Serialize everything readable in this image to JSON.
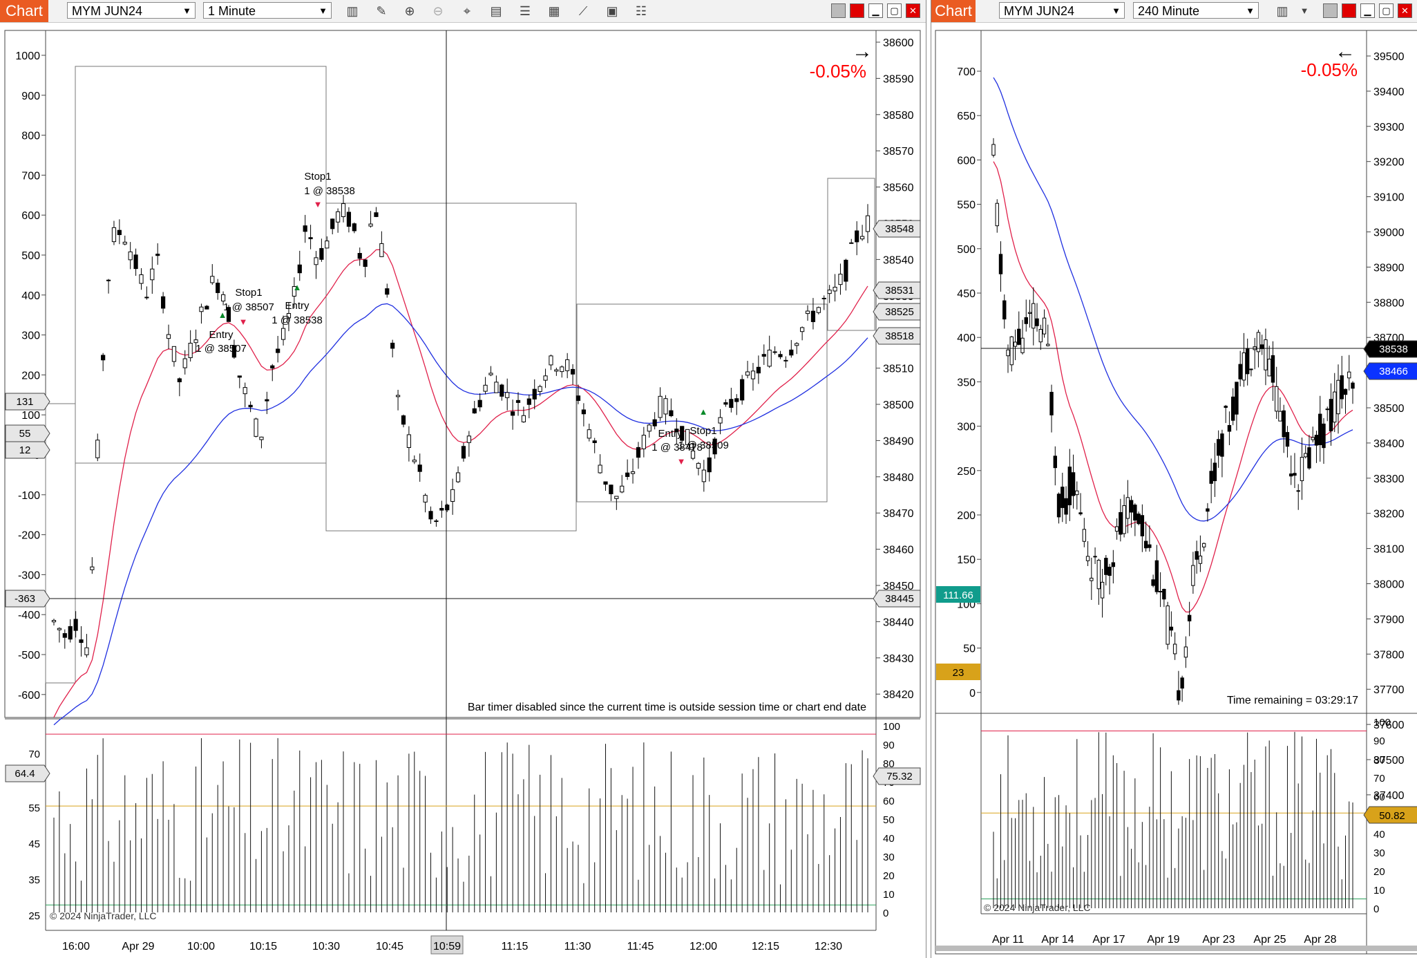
{
  "left": {
    "tab_label": "Chart",
    "instrument": "MYM JUN24",
    "interval": "1 Minute",
    "change_pct": "-0.05%",
    "bar_timer_note": "Bar timer disabled since the current time is outside session time or chart end date",
    "copyright": "© 2024 NinjaTrader, LLC",
    "right_axis_ticks": [
      "38600",
      "38590",
      "38580",
      "38570",
      "38560",
      "38550",
      "38540",
      "38530",
      "38520",
      "38510",
      "38500",
      "38490",
      "38480",
      "38470",
      "38460",
      "38450",
      "38440",
      "38430",
      "38420"
    ],
    "left_axis_ticks": [
      "1000",
      "900",
      "800",
      "700",
      "600",
      "500",
      "400",
      "300",
      "200",
      "100",
      "0",
      "-100",
      "-200",
      "-300",
      "-400",
      "-500",
      "-600"
    ],
    "price_markers": [
      "38548",
      "38531",
      "38525",
      "38518",
      "38445"
    ],
    "left_markers": [
      "131",
      "55",
      "12",
      "-363"
    ],
    "crosshair_time": "10:59",
    "time_labels": [
      "16:00",
      "Apr 29",
      "10:00",
      "10:15",
      "10:30",
      "10:45",
      "11:15",
      "11:30",
      "11:45",
      "12:00",
      "12:15",
      "12:30"
    ],
    "orders": [
      {
        "name": "Stop1",
        "detail": "1 @ 38538"
      },
      {
        "name": "Stop1",
        "detail": "1 @ 38507"
      },
      {
        "name": "Entry",
        "detail": "1 @ 38538"
      },
      {
        "name": "Entry",
        "detail": "1 @ 38507"
      },
      {
        "name": "Stop1",
        "detail": "1 @ 38509"
      },
      {
        "name": "Entry",
        "detail": "1 @ 38478"
      }
    ],
    "ind_left_ticks": [
      "70",
      "55",
      "45",
      "35",
      "25"
    ],
    "ind_left_marker": "64.4",
    "ind_right_ticks": [
      "100",
      "90",
      "80",
      "70",
      "60",
      "50",
      "40",
      "30",
      "20",
      "10",
      "0"
    ],
    "ind_right_marker": "75.32"
  },
  "right": {
    "tab_label": "Chart",
    "instrument": "MYM JUN24",
    "interval": "240 Minute",
    "change_pct": "-0.05%",
    "time_remaining": "Time remaining = 03:29:17",
    "copyright": "© 2024 NinjaTrader, LLC",
    "right_axis_ticks": [
      "39500",
      "39400",
      "39300",
      "39200",
      "39100",
      "39000",
      "38900",
      "38800",
      "38700",
      "38600",
      "38500",
      "38400",
      "38300",
      "38200",
      "38100",
      "38000",
      "37900",
      "37800",
      "37700",
      "37600",
      "37500",
      "37400"
    ],
    "left_axis_ticks": [
      "700",
      "650",
      "600",
      "550",
      "500",
      "450",
      "400",
      "350",
      "300",
      "250",
      "200",
      "150",
      "100",
      "50",
      "0"
    ],
    "price_markers": [
      "38538",
      "38466"
    ],
    "left_markers": [
      "111.66",
      "23"
    ],
    "time_labels": [
      "Apr 11",
      "Apr 14",
      "Apr 17",
      "Apr 19",
      "Apr 23",
      "Apr 25",
      "Apr 28"
    ],
    "ind_right_ticks": [
      "100",
      "90",
      "80",
      "70",
      "60",
      "50",
      "40",
      "30",
      "20",
      "10",
      "0"
    ],
    "ind_right_marker": "50.82"
  },
  "colors": {
    "tab": "#ea5b22",
    "pct": "#ff0000",
    "ema_fast": "#e0204a",
    "ema_slow": "#1f2fe0",
    "level_red": "#e0204a",
    "level_gold": "#d8a21a",
    "level_green": "#2aa05a",
    "marker_teal": "#109c8c",
    "marker_gold": "#d8a21a",
    "marker_blue": "#0b33ff"
  }
}
